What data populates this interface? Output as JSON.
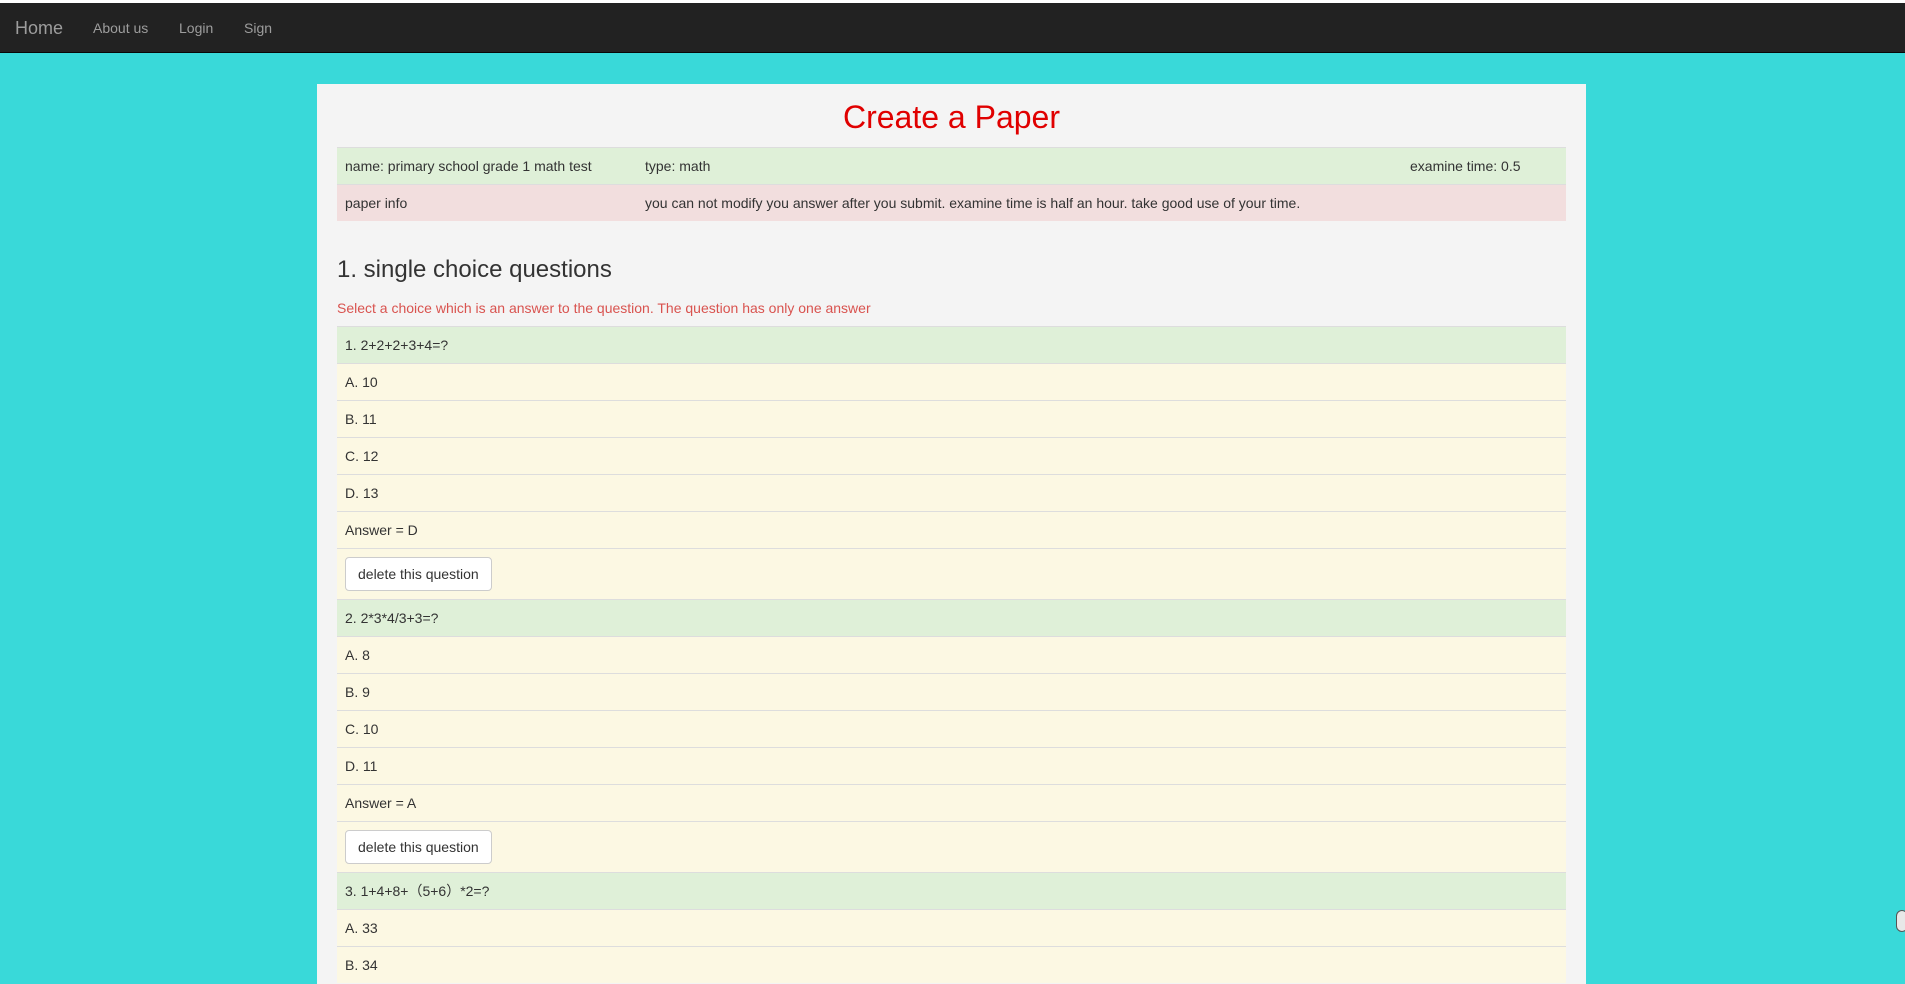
{
  "navbar": {
    "brand": "Home",
    "links": [
      "About us",
      "Login",
      "Sign"
    ]
  },
  "page": {
    "title": "Create a Paper"
  },
  "paper": {
    "name": "name: primary school grade 1 math test",
    "type": "type: math",
    "examine_time": "examine time: 0.5",
    "info_label": "paper info",
    "info_text": "you can not modify you answer after you submit. examine time is half an hour. take good use of your time."
  },
  "section": {
    "title": "1. single choice questions",
    "subtitle": "Select a choice which is an answer to the question. The question has only one answer"
  },
  "questions": [
    {
      "text": "1. 2+2+2+3+4=?",
      "options": [
        "A. 10",
        "B. 11",
        "C. 12",
        "D. 13"
      ],
      "answer": "Answer = D",
      "delete_label": "delete this question"
    },
    {
      "text": "2. 2*3*4/3+3=?",
      "options": [
        "A. 8",
        "B. 9",
        "C. 10",
        "D. 11"
      ],
      "answer": "Answer = A",
      "delete_label": "delete this question"
    },
    {
      "text": "3. 1+4+8+（5+6）*2=?",
      "options": [
        "A. 33",
        "B. 34"
      ],
      "answer": "",
      "delete_label": ""
    }
  ],
  "colors": {
    "page_background": "#39d9d9",
    "navbar": "#222222",
    "title": "#e00000",
    "success_row": "#dff0d8",
    "danger_row": "#f2dede",
    "warning_row": "#fcf8e3"
  }
}
